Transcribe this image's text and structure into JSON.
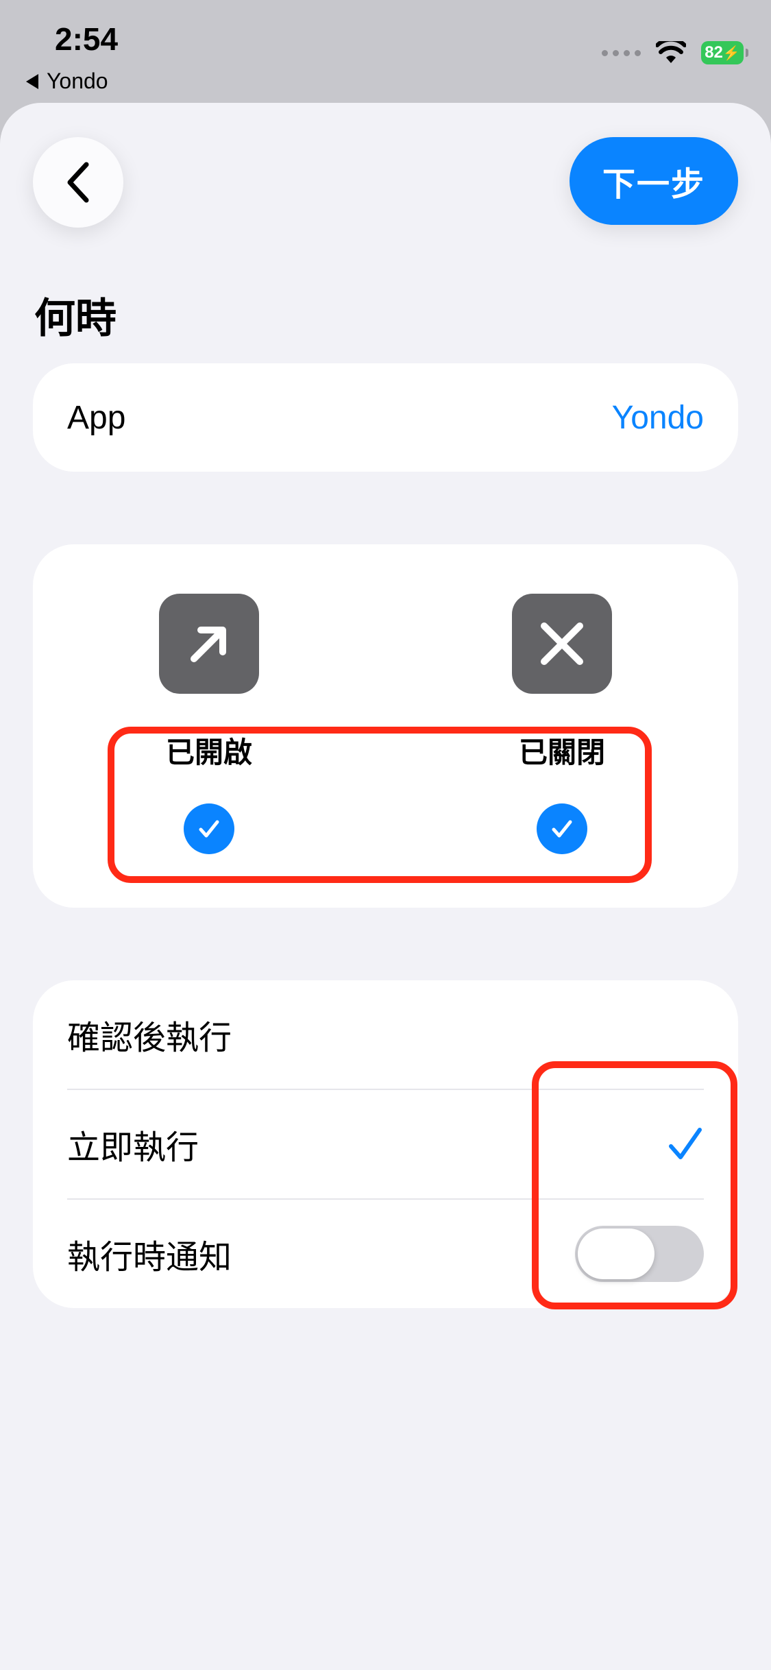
{
  "status_bar": {
    "time": "2:54",
    "back_app": "Yondo",
    "battery": "82"
  },
  "header": {
    "back_icon": "chevron-left-icon",
    "next_label": "下一步"
  },
  "section": {
    "title": "何時"
  },
  "app_row": {
    "label": "App",
    "value": "Yondo"
  },
  "states": [
    {
      "label": "已開啟",
      "icon": "arrow-up-right-icon",
      "checked": true
    },
    {
      "label": "已關閉",
      "icon": "close-x-icon",
      "checked": true
    }
  ],
  "run_options": {
    "confirm_label": "確認後執行",
    "immediate_label": "立即執行",
    "immediate_selected": true,
    "notify_label": "執行時通知",
    "notify_on": false
  },
  "colors": {
    "accent": "#0a84ff",
    "highlight": "#ff2a16"
  }
}
